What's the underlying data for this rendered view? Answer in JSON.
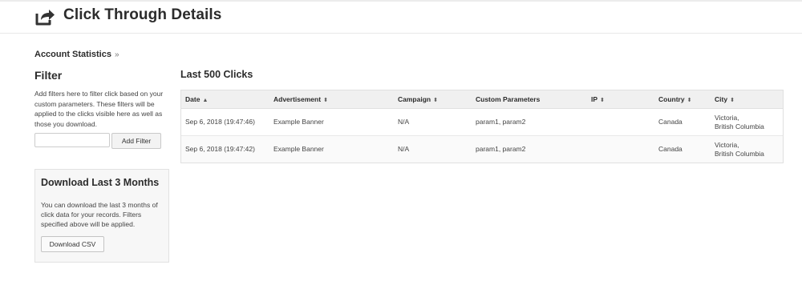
{
  "header": {
    "title": "Click Through Details",
    "icon": "share-arrow-icon"
  },
  "breadcrumb": {
    "label": "Account Statistics",
    "separator": "»"
  },
  "filter": {
    "title": "Filter",
    "description": "Add filters here to filter click based on your custom parameters. These filters will be applied to the clicks visible here as well as those you download.",
    "input_value": "",
    "add_button": "Add Filter"
  },
  "download": {
    "title": "Download Last 3 Months",
    "description": "You can download the last 3 months of click data for your records. Filters specified above will be applied.",
    "button": "Download CSV"
  },
  "clicks": {
    "title": "Last 500 Clicks",
    "columns": [
      {
        "label": "Date",
        "sort": "▲"
      },
      {
        "label": "Advertisement",
        "sort": "⬍"
      },
      {
        "label": "Campaign",
        "sort": "⬍"
      },
      {
        "label": "Custom Parameters",
        "sort": ""
      },
      {
        "label": "IP",
        "sort": "⬍"
      },
      {
        "label": "Country",
        "sort": "⬍"
      },
      {
        "label": "City",
        "sort": "⬍"
      }
    ],
    "rows": [
      {
        "date": "Sep 6, 2018 (19:47:46)",
        "advertisement": "Example Banner",
        "campaign": "N/A",
        "params": "param1, param2",
        "ip": "",
        "country": "Canada",
        "city_line1": "Victoria,",
        "city_line2": "British Columbia"
      },
      {
        "date": "Sep 6, 2018 (19:47:42)",
        "advertisement": "Example Banner",
        "campaign": "N/A",
        "params": "param1, param2",
        "ip": "",
        "country": "Canada",
        "city_line1": "Victoria,",
        "city_line2": "British Columbia"
      }
    ]
  }
}
